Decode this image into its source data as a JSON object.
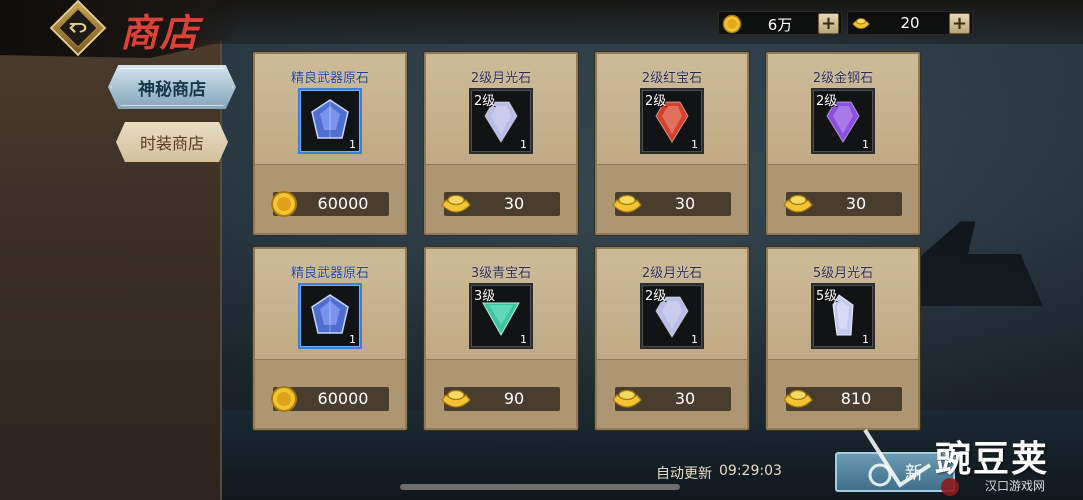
{
  "header": {
    "title": "商店",
    "currency": [
      {
        "icon": "gold-coin-icon",
        "value": "6万"
      },
      {
        "icon": "gold-ingot-icon",
        "value": "20"
      }
    ]
  },
  "sidebar": {
    "tabs": [
      {
        "label": "神秘商店",
        "active": true
      },
      {
        "label": "时装商店",
        "active": false
      }
    ]
  },
  "items": [
    {
      "name": "精良武器原石",
      "level": "",
      "qty": "1",
      "gem": "sapphire",
      "color": "#4f6fd0",
      "currency": "coin",
      "price": "60000"
    },
    {
      "name": "2级月光石",
      "level": "2级",
      "qty": "1",
      "gem": "moonstone",
      "color": "#b7bde6",
      "currency": "ingot",
      "price": "30"
    },
    {
      "name": "2级红宝石",
      "level": "2级",
      "qty": "1",
      "gem": "ruby",
      "color": "#d6402a",
      "currency": "ingot",
      "price": "30"
    },
    {
      "name": "2级金钢石",
      "level": "2级",
      "qty": "1",
      "gem": "amethyst",
      "color": "#8a4ee0",
      "currency": "ingot",
      "price": "30"
    },
    {
      "name": "精良武器原石",
      "level": "",
      "qty": "1",
      "gem": "sapphire",
      "color": "#4f6fd0",
      "currency": "coin",
      "price": "60000"
    },
    {
      "name": "3级青宝石",
      "level": "3级",
      "qty": "1",
      "gem": "emerald",
      "color": "#3ec4a0",
      "currency": "ingot",
      "price": "90"
    },
    {
      "name": "2级月光石",
      "level": "2级",
      "qty": "1",
      "gem": "moonstone",
      "color": "#b7bde6",
      "currency": "ingot",
      "price": "30"
    },
    {
      "name": "5级月光石",
      "level": "5级",
      "qty": "1",
      "gem": "moonstone-long",
      "color": "#c4c9ef",
      "currency": "ingot",
      "price": "810"
    }
  ],
  "footer": {
    "refresh_label": "自动更新",
    "refresh_time": "09:29:03",
    "refresh_button": "新"
  },
  "watermark": {
    "text": "豌豆荚",
    "sub": "汉口游戏网"
  }
}
